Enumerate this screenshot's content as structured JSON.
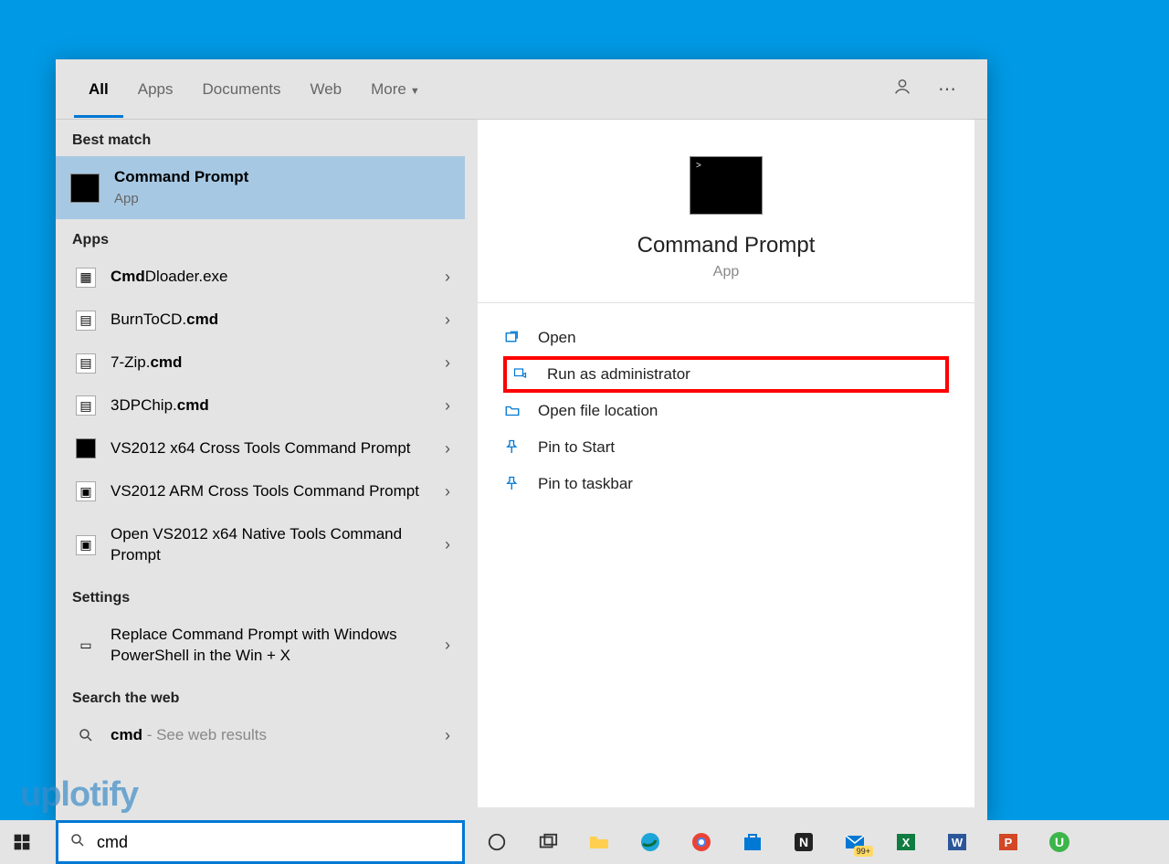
{
  "tabs": {
    "all": "All",
    "apps": "Apps",
    "documents": "Documents",
    "web": "Web",
    "more": "More"
  },
  "sections": {
    "bestMatch": "Best match",
    "apps": "Apps",
    "settings": "Settings",
    "searchWeb": "Search the web"
  },
  "bestMatch": {
    "title": "Command Prompt",
    "subtitle": "App"
  },
  "appsList": [
    {
      "label": "CmdDloader.exe"
    },
    {
      "label": "BurnToCD.cmd"
    },
    {
      "label": "7-Zip.cmd"
    },
    {
      "label": "3DPChip.cmd"
    },
    {
      "label": "VS2012 x64 Cross Tools Command Prompt"
    },
    {
      "label": "VS2012 ARM Cross Tools Command Prompt"
    },
    {
      "label": "Open VS2012 x64 Native Tools Command Prompt"
    }
  ],
  "settingsList": [
    {
      "label": "Replace Command Prompt with Windows PowerShell in the Win + X"
    }
  ],
  "webSearch": {
    "prefix": "cmd",
    "suffix": " - See web results"
  },
  "preview": {
    "title": "Command Prompt",
    "subtitle": "App"
  },
  "actions": {
    "open": "Open",
    "runAdmin": "Run as administrator",
    "openLocation": "Open file location",
    "pinStart": "Pin to Start",
    "pinTaskbar": "Pin to taskbar"
  },
  "searchInput": {
    "value": "cmd"
  },
  "watermark": "uplotify",
  "taskbar": {
    "mailBadge": "99+"
  }
}
